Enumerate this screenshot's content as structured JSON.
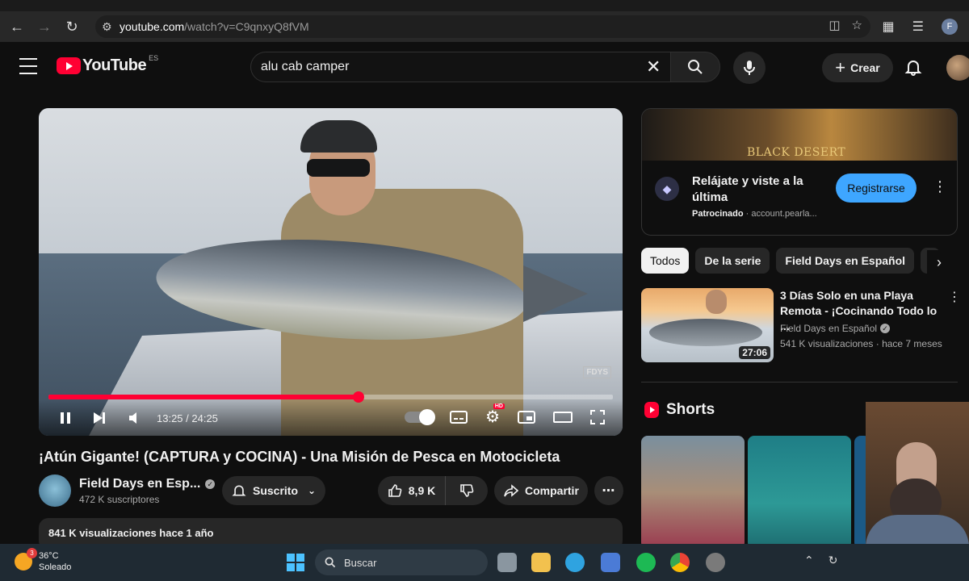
{
  "browser": {
    "url_host": "youtube.com",
    "url_path": "/watch?v=C9qnxyQ8fVM",
    "profile_initial": "F"
  },
  "header": {
    "logo_text": "YouTube",
    "logo_region": "ES",
    "search_query": "alu cab camper",
    "create_label": "Crear"
  },
  "player": {
    "time_display": "13:25 / 24:25",
    "progress_fraction": 0.55,
    "watermark": "FDYS",
    "hd_badge": "HD"
  },
  "video": {
    "title": "¡Atún Gigante! (CAPTURA y COCINA) - Una Misión de Pesca en Motocicleta",
    "channel_name": "Field Days en Esp...",
    "subscribers": "472 K suscriptores",
    "subscribed_label": "Suscrito",
    "likes": "8,9 K",
    "share_label": "Compartir",
    "views_date": "841 K visualizaciones  hace 1 año"
  },
  "ad": {
    "banner_text": "BLACK DESERT",
    "title": "Relájate y viste a la última",
    "sponsored_label": "Patrocinado",
    "sponsor_domain": "· account.pearla...",
    "cta_label": "Registrarse"
  },
  "chips": [
    "Todos",
    "De la serie",
    "Field Days en Español"
  ],
  "recommended": {
    "title": "3 Días Solo en una Playa Remota - ¡Cocinando Todo lo ...",
    "channel": "Field Days en Español",
    "meta": "541 K visualizaciones · hace 7 meses",
    "duration": "27:06"
  },
  "shorts": {
    "label": "Shorts"
  },
  "taskbar": {
    "temperature": "36°C",
    "condition": "Soleado",
    "weather_badge": "3",
    "search_label": "Buscar"
  },
  "colors": {
    "accent_red": "#ff0033",
    "cta_blue": "#3ea6ff",
    "background": "#0f0f0f"
  }
}
